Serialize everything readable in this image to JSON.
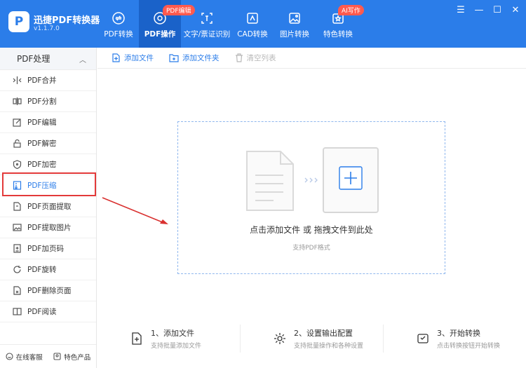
{
  "app": {
    "logo_text": "P",
    "title": "迅捷PDF转换器",
    "version": "v1.1.7.0"
  },
  "nav": {
    "items": [
      {
        "label": "PDF转换",
        "icon": "convert-icon"
      },
      {
        "label": "PDF操作",
        "icon": "pdf-operation-icon",
        "badge": "PDF编辑"
      },
      {
        "label": "文字/票证识别",
        "icon": "ocr-icon"
      },
      {
        "label": "CAD转换",
        "icon": "cad-icon"
      },
      {
        "label": "图片转换",
        "icon": "image-icon"
      },
      {
        "label": "特色转换",
        "icon": "feature-icon",
        "badge": "AI写作"
      }
    ]
  },
  "sidebar": {
    "header": "PDF处理",
    "items": [
      {
        "label": "PDF合并",
        "icon": "merge-icon"
      },
      {
        "label": "PDF分割",
        "icon": "split-icon"
      },
      {
        "label": "PDF编辑",
        "icon": "edit-icon"
      },
      {
        "label": "PDF解密",
        "icon": "unlock-icon"
      },
      {
        "label": "PDF加密",
        "icon": "shield-icon"
      },
      {
        "label": "PDF压缩",
        "icon": "compress-icon"
      },
      {
        "label": "PDF页面提取",
        "icon": "page-extract-icon"
      },
      {
        "label": "PDF提取图片",
        "icon": "image-extract-icon"
      },
      {
        "label": "PDF加页码",
        "icon": "page-number-icon"
      },
      {
        "label": "PDF旋转",
        "icon": "rotate-icon"
      },
      {
        "label": "PDF删除页面",
        "icon": "delete-page-icon"
      },
      {
        "label": "PDF阅读",
        "icon": "book-icon"
      }
    ],
    "footer": {
      "service": "在线客服",
      "products": "特色产品"
    }
  },
  "toolbar": {
    "add_file": "添加文件",
    "add_folder": "添加文件夹",
    "clear_list": "清空列表"
  },
  "drop_zone": {
    "main_text": "点击添加文件 或 拖拽文件到此处",
    "sub_text": "支持PDF格式"
  },
  "steps": [
    {
      "title": "1、添加文件",
      "sub": "支持批量添加文件",
      "icon": "add-file-icon"
    },
    {
      "title": "2、设置输出配置",
      "sub": "支持批量操作和各种设置",
      "icon": "settings-icon"
    },
    {
      "title": "3、开始转换",
      "sub": "点击转换按钮开始转换",
      "icon": "start-convert-icon"
    }
  ],
  "colors": {
    "primary": "#2b7de9",
    "nav_active": "#1a62c9",
    "badge": "#ff5a4e",
    "annotation_red": "#e33a3a"
  }
}
